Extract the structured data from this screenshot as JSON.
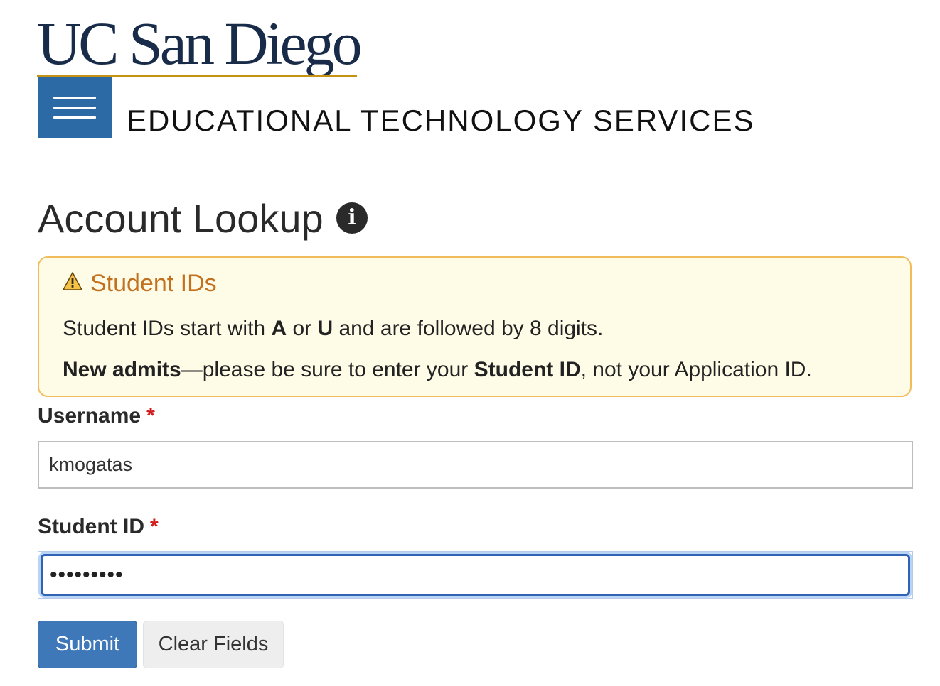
{
  "logo": {
    "text": "UC San Diego",
    "accent_color": "#c69214",
    "color": "#182b49"
  },
  "header": {
    "menu_icon": "hamburger-menu-icon",
    "site_title": "EDUCATIONAL TECHNOLOGY SERVICES",
    "menu_color": "#2c6aa5"
  },
  "page": {
    "title": "Account Lookup",
    "info_icon": "info-circle-icon",
    "info_glyph": "i"
  },
  "notice": {
    "icon": "warning-triangle-icon",
    "title": "Student IDs",
    "line1": {
      "part1": "Student IDs start with ",
      "bold1": "A",
      "part2": " or ",
      "bold2": "U",
      "part3": " and are followed by 8 digits."
    },
    "line2": {
      "bold1": "New admits",
      "part1": "—please be sure to enter your ",
      "bold2": "Student ID",
      "part2": ", not your Application ID."
    },
    "title_color": "#c2711f",
    "background": "#fefbe7",
    "border_color": "#f0bd5a"
  },
  "form": {
    "username": {
      "label": "Username",
      "required_mark": "*",
      "value": "kmogatas"
    },
    "student_id": {
      "label": "Student ID",
      "required_mark": "*",
      "value": "•••••••••"
    },
    "submit_label": "Submit",
    "clear_label": "Clear Fields",
    "primary_color": "#3f78b8"
  }
}
